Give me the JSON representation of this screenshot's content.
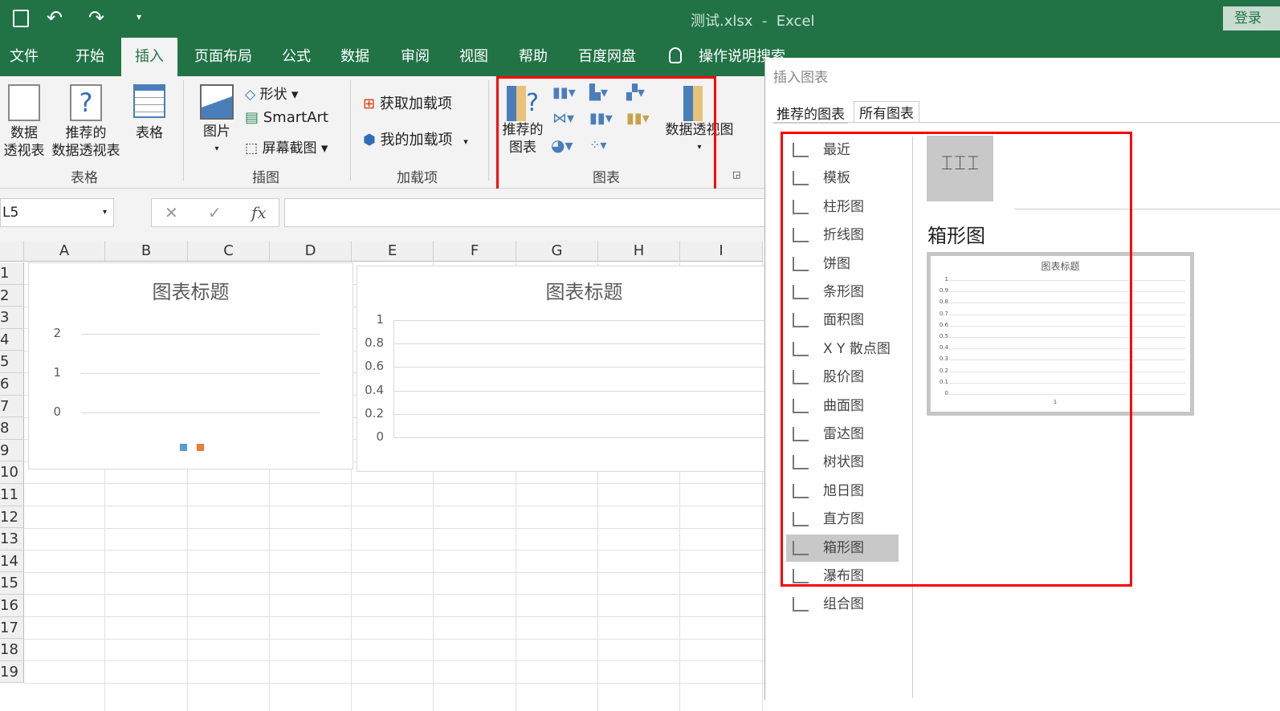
{
  "titlebar": {
    "title": "测试.xlsx  -  Excel",
    "login": "登录"
  },
  "tabs": [
    "文件",
    "开始",
    "插入",
    "页面布局",
    "公式",
    "数据",
    "审阅",
    "视图",
    "帮助",
    "百度网盘",
    "操作说明搜索"
  ],
  "ribbon": {
    "tables": {
      "pivot": "数据\n透视表",
      "rec_pivot": "推荐的\n数据透视表",
      "table": "表格",
      "group": "表格"
    },
    "illus": {
      "pictures": "图片",
      "shapes": "形状",
      "smartart": "SmartArt",
      "screenshot": "屏幕截图",
      "group": "插图"
    },
    "addins": {
      "get": "获取加载项",
      "my": "我的加载项",
      "group": "加载项"
    },
    "charts": {
      "recommended": "推荐的\n图表",
      "pivotchart": "数据透视图",
      "group": "图表"
    }
  },
  "formula_bar": {
    "name_box": "L5",
    "fx": "fx",
    "value": ""
  },
  "columns": [
    "A",
    "B",
    "C",
    "D",
    "E",
    "F",
    "G",
    "H",
    "I"
  ],
  "rows": [
    "1",
    "2",
    "3",
    "4",
    "5",
    "6",
    "7",
    "8",
    "9",
    "10",
    "11",
    "12",
    "13",
    "14",
    "15",
    "16",
    "17",
    "18",
    "19"
  ],
  "chart_data": [
    {
      "type": "line",
      "title": "图表标题",
      "ylim": [
        0,
        2
      ],
      "yticks": [
        "2",
        "1",
        "0"
      ],
      "legend_colors": [
        "#5b9bd5",
        "#ed7d31"
      ],
      "legend": "bottom"
    },
    {
      "type": "bar",
      "title": "图表标题",
      "ylim": [
        0,
        1
      ],
      "yticks": [
        "1",
        "0.8",
        "0.6",
        "0.4",
        "0.2",
        "0"
      ]
    },
    {
      "type": "boxwhisker",
      "title": "图表标题",
      "ylim": [
        0,
        1
      ],
      "yticks": [
        "1",
        "0.9",
        "0.8",
        "0.7",
        "0.6",
        "0.5",
        "0.4",
        "0.3",
        "0.2",
        "0.1",
        "0"
      ],
      "xticks": [
        "1"
      ]
    }
  ],
  "dialog": {
    "title": "插入图表",
    "tabs": [
      "推荐的图表",
      "所有图表"
    ],
    "items": [
      "最近",
      "模板",
      "柱形图",
      "折线图",
      "饼图",
      "条形图",
      "面积图",
      "X Y 散点图",
      "股价图",
      "曲面图",
      "雷达图",
      "树状图",
      "旭日图",
      "直方图",
      "箱形图",
      "瀑布图",
      "组合图"
    ],
    "selected": "箱形图",
    "preview_title": "箱形图"
  },
  "colors": {
    "excel_green": "#217346",
    "highlight": "#ff0000",
    "selected_bg": "#c8c8c8"
  }
}
